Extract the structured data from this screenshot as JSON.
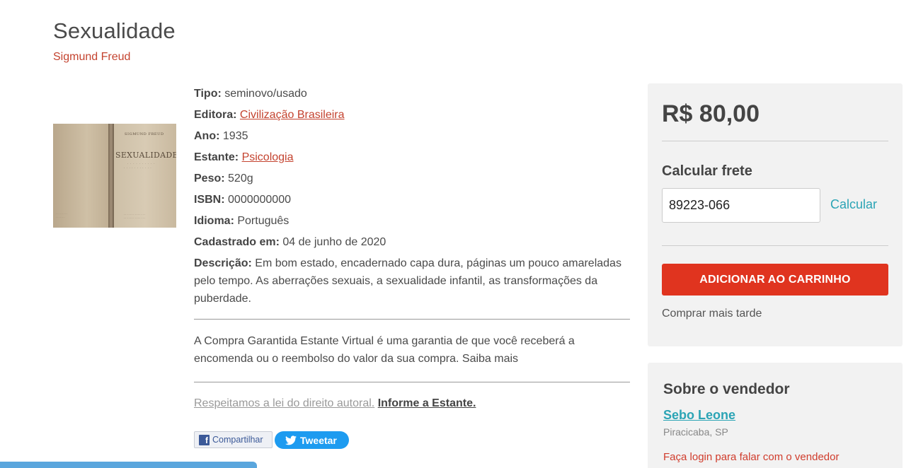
{
  "book": {
    "title": "Sexualidade",
    "author": "Sigmund Freud"
  },
  "cover": {
    "author_text": "SIGMUND FREUD",
    "title_text": "SEXUALIDADE"
  },
  "details": {
    "tipo_label": "Tipo:",
    "tipo_value": "seminovo/usado",
    "editora_label": "Editora:",
    "editora_value": "Civilização Brasileira",
    "ano_label": "Ano:",
    "ano_value": "1935",
    "estante_label": "Estante:",
    "estante_value": "Psicologia",
    "peso_label": "Peso:",
    "peso_value": "520g",
    "isbn_label": "ISBN:",
    "isbn_value": "0000000000",
    "idioma_label": "Idioma:",
    "idioma_value": "Português",
    "cadastrado_label": "Cadastrado em:",
    "cadastrado_value": "04 de junho de 2020",
    "descricao_label": "Descrição:",
    "descricao_value": "Em bom estado, encadernado capa dura, páginas um pouco amareladas pelo tempo. As aberrações sexuais, a sexualidade infantil, as transformações da puberdade."
  },
  "guarantee_text": "A Compra Garantida Estante Virtual é uma garantia de que você receberá a encomenda ou o reembolso do valor da sua compra. Saiba mais",
  "copyright": {
    "text": "Respeitamos a lei do direito autoral.",
    "link": "Informe a Estante."
  },
  "share": {
    "facebook_label": "Compartilhar",
    "twitter_label": "Tweetar"
  },
  "buybox": {
    "price": "R$ 80,00",
    "frete_title": "Calcular frete",
    "cep_value": "89223-066",
    "calcular_label": "Calcular",
    "add_to_cart_label": "ADICIONAR AO CARRINHO",
    "buy_later_label": "Comprar mais tarde"
  },
  "seller": {
    "title": "Sobre o vendedor",
    "name": "Sebo Leone",
    "location": "Piracicaba, SP",
    "login_text": "Faça login para falar com o vendedor"
  },
  "colors": {
    "accent_red": "#e0341f",
    "link_red": "#c4432f",
    "seller_teal": "#2ba4b5",
    "twitter_blue": "#1d9bf0",
    "facebook_blue": "#3b5998"
  }
}
